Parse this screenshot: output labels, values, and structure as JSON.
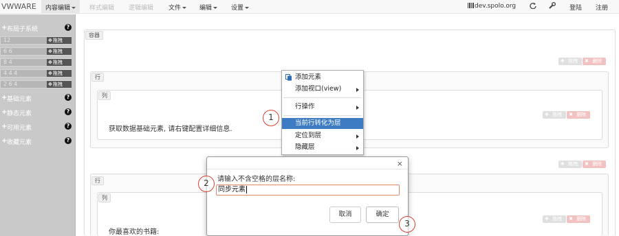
{
  "navbar": {
    "brand": "VWWARE",
    "menus": [
      {
        "label": "内容编辑",
        "caret": true,
        "active": true,
        "disabled": false
      },
      {
        "label": "样式编辑",
        "caret": false,
        "active": false,
        "disabled": true
      },
      {
        "label": "逻辑编辑",
        "caret": false,
        "active": false,
        "disabled": true
      },
      {
        "label": "文件",
        "caret": true,
        "active": false,
        "disabled": false
      },
      {
        "label": "编辑",
        "caret": true,
        "active": false,
        "disabled": false
      },
      {
        "label": "设置",
        "caret": true,
        "active": false,
        "disabled": false
      }
    ],
    "site": "dev.spolo.org",
    "login": "登陆",
    "register": "注册"
  },
  "sidebar": {
    "layout_section": "布局子系统",
    "layout_rows": [
      "12",
      "6 6",
      "8 4",
      "4 4 4",
      "2 6 4"
    ],
    "drag_label": "拖拽",
    "sections": [
      "基础元素",
      "静态元素",
      "可用元素",
      "收藏元素"
    ]
  },
  "content": {
    "container_tag": "容器",
    "row_tag": "行",
    "col_tag": "列",
    "drag_label": "拖拽",
    "delete_label": "删除",
    "info_text": "获取数据基础元素, 请右键配置详细信息.",
    "books_text": "你最喜欢的书籍:"
  },
  "context_menu": {
    "items": [
      {
        "label": "添加元素",
        "submenu": false
      },
      {
        "label": "添加视口(view)",
        "submenu": true
      },
      {
        "label": "行操作",
        "submenu": true
      },
      {
        "label": "当前行转化为层",
        "submenu": false,
        "highlighted": true
      },
      {
        "label": "定位到层",
        "submenu": true
      },
      {
        "label": "隐藏层",
        "submenu": true
      }
    ]
  },
  "dialog": {
    "close": "×",
    "prompt": "请输入不含空格的层名称:",
    "input_value": "同步元素",
    "cancel": "取消",
    "confirm": "确定"
  },
  "annotations": [
    "1",
    "2",
    "3"
  ],
  "colors": {
    "highlight": "#3d7bc3",
    "annotation": "#d9402f",
    "sidebar": "#c9c9c9"
  }
}
